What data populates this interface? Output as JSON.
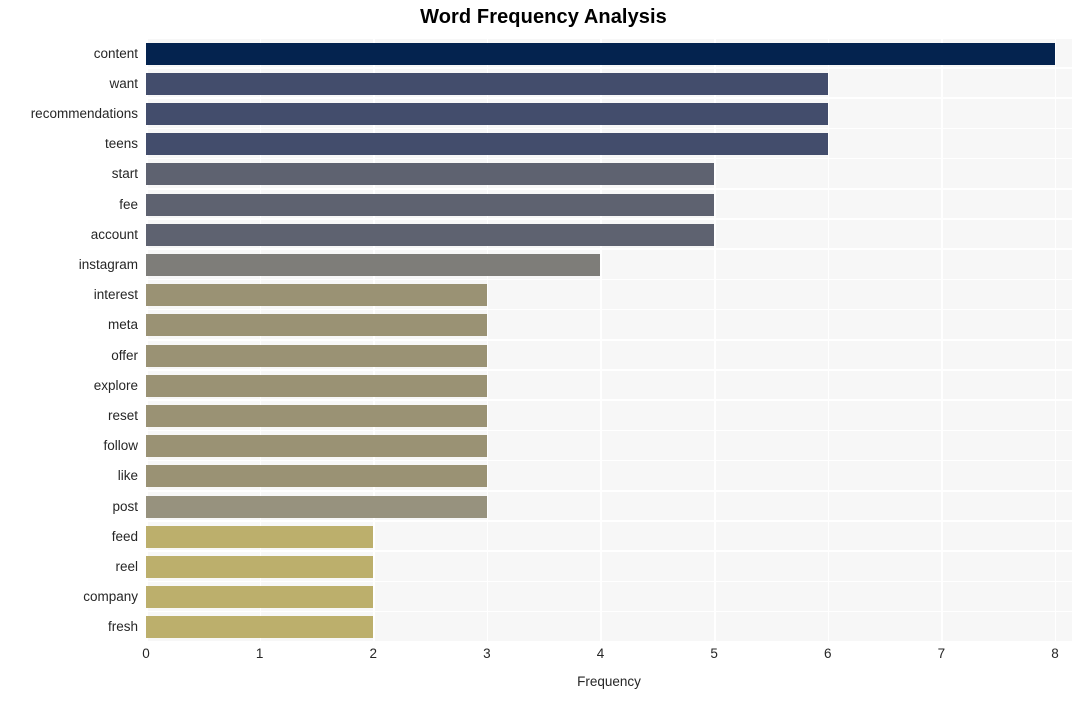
{
  "chart_data": {
    "type": "bar",
    "orientation": "horizontal",
    "title": "Word Frequency Analysis",
    "xlabel": "Frequency",
    "ylabel": "",
    "xlim": [
      0,
      8.15
    ],
    "xticks": [
      0,
      1,
      2,
      3,
      4,
      5,
      6,
      7,
      8
    ],
    "grid": "vertical-white-on-light-gray",
    "legend": "none",
    "categories": [
      "content",
      "want",
      "recommendations",
      "teens",
      "start",
      "fee",
      "account",
      "instagram",
      "interest",
      "meta",
      "offer",
      "explore",
      "reset",
      "follow",
      "like",
      "post",
      "feed",
      "reel",
      "company",
      "fresh"
    ],
    "values": [
      8,
      6,
      6,
      6,
      5,
      5,
      5,
      4,
      3,
      3,
      3,
      3,
      3,
      3,
      3,
      3,
      2,
      2,
      2,
      2
    ],
    "bar_colors": [
      "#04234f",
      "#434d6c",
      "#434d6c",
      "#434d6c",
      "#5e6270",
      "#5e6270",
      "#5e6270",
      "#7e7d79",
      "#9a9274",
      "#9a9274",
      "#9a9274",
      "#9a9274",
      "#9a9274",
      "#9a9274",
      "#9a9274",
      "#97927e",
      "#bcaf6c",
      "#bcaf6c",
      "#bcaf6c",
      "#bcaf6c"
    ],
    "plot_background": "#f7f7f7",
    "gridline_color": "#ffffff",
    "text_color": "#262626"
  }
}
